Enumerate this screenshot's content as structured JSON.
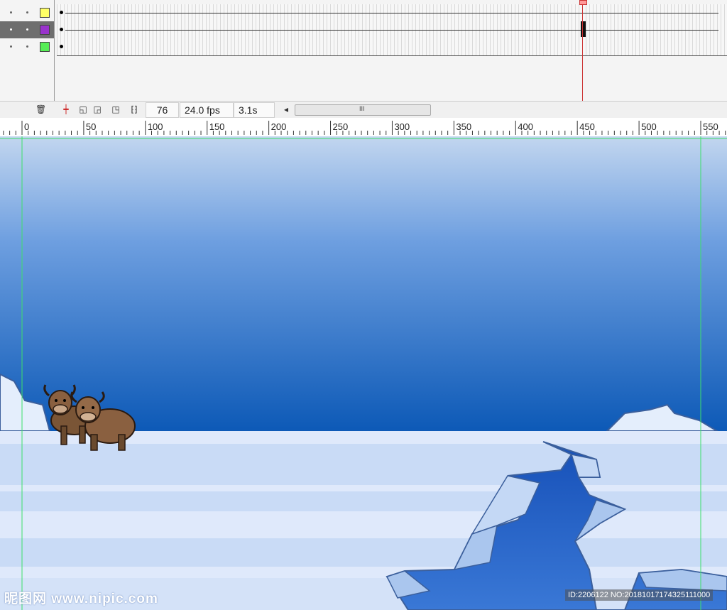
{
  "timeline": {
    "layers": [
      {
        "swatch_color": "#ffff66",
        "active": false
      },
      {
        "swatch_color": "#9933cc",
        "active": true
      },
      {
        "swatch_color": "#55ee55",
        "active": false
      }
    ],
    "current_frame": "76",
    "frame_rate": "24.0 fps",
    "elapsed_time": "3.1s",
    "scroll_left_arrow": "◂",
    "scroll_grip": "III",
    "trash_icon": "delete-layer-icon"
  },
  "ruler": {
    "labels": [
      "0",
      "50",
      "100",
      "150",
      "200",
      "250",
      "300",
      "350",
      "400",
      "450",
      "500",
      "550"
    ]
  },
  "stage": {
    "sky_top_color": "#c0d4ee",
    "sky_bottom_color": "#0c5ab8",
    "ice_color": "#dce8fa",
    "water_color": "#1a5cc0",
    "guide_color": "#3ce06a"
  },
  "watermark": {
    "left_text": "昵图网 www.nipic.com",
    "right_text": "ID:2206122 NO:20181017174325111000"
  }
}
